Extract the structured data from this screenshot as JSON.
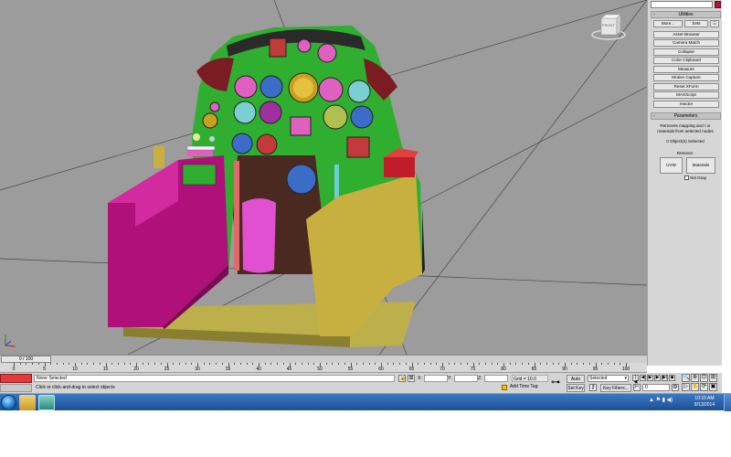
{
  "viewport": {
    "viewcube_label": "FRONT"
  },
  "command_panel": {
    "utilities_header": "Utilities",
    "more_label": "More...",
    "sets_label": "Sets",
    "utilities": [
      "Asset Browser",
      "Camera Match",
      "Collapse",
      "Color Clipboard",
      "Measure",
      "Motion Capture",
      "Reset XForm",
      "MAXScript",
      "reactor"
    ],
    "parameters_header": "Parameters",
    "parameters_desc": "Removes mapping and / or materials from selected nodes",
    "objects_selected": "0 Object(s) Selected",
    "remove_label": "Remove:",
    "uvw_label": "UVW",
    "materials_label": "Materials",
    "set_gray_label": "Set Gray",
    "collapse_symbol": "-"
  },
  "timeline": {
    "slider_label": "0 / 100",
    "ticks": [
      "0",
      "5",
      "10",
      "15",
      "20",
      "25",
      "30",
      "35",
      "40",
      "45",
      "50",
      "55",
      "60",
      "65",
      "70",
      "75",
      "80",
      "85",
      "90",
      "95",
      "100"
    ]
  },
  "status": {
    "selection": "None Selected",
    "prompt": "Click or click-and-drag to select objects",
    "x_label": "X:",
    "y_label": "Y:",
    "z_label": "Z:",
    "grid": "Grid = 10.0",
    "add_time_tag": "Add Time Tag",
    "auto_key": "Auto Key",
    "set_key": "Set Key",
    "selected_option": "Selected",
    "key_filters": "Key Filters...",
    "frame": "0"
  },
  "taskbar": {
    "time": "10:10 AM",
    "date": "8/13/2014"
  },
  "colors": {
    "viewport_bg": "#9c9c9c",
    "accent_red": "#e23a3a",
    "taskbar": "#2a62ad"
  }
}
